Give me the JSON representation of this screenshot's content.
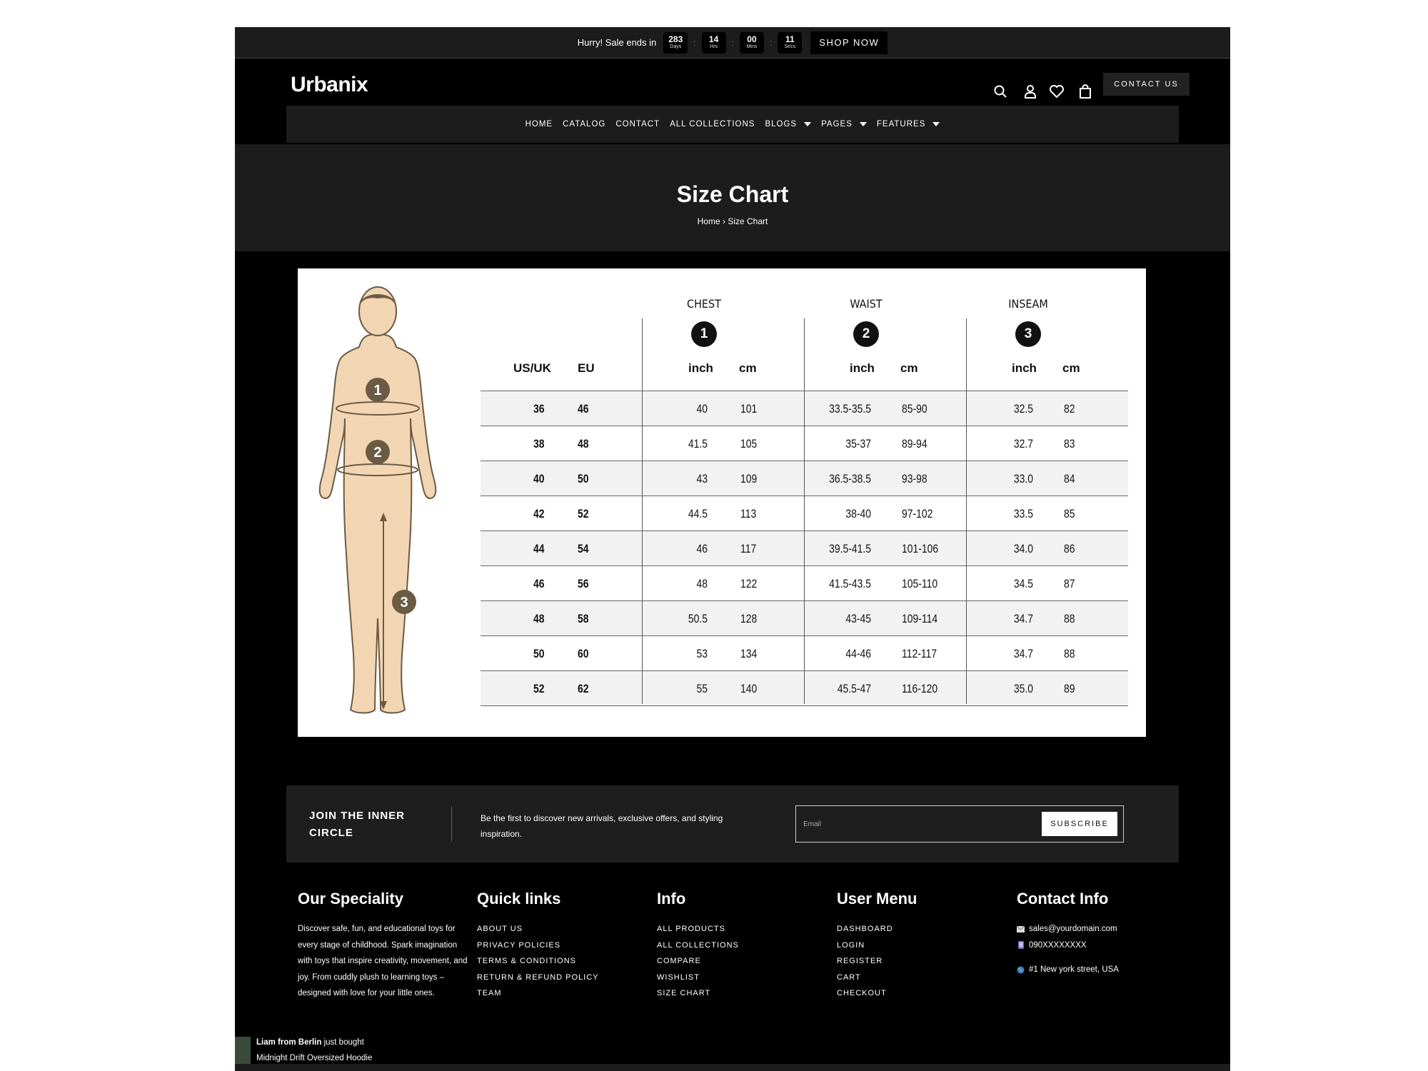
{
  "announcement": {
    "text": "Hurry! Sale ends in",
    "countdown": [
      {
        "value": "283",
        "unit": "Days"
      },
      {
        "value": "14",
        "unit": "Hrs"
      },
      {
        "value": "00",
        "unit": "Mins"
      },
      {
        "value": "11",
        "unit": "Secs"
      }
    ],
    "cta": "SHOP NOW"
  },
  "header": {
    "logo": "Urbanix",
    "contact_button": "CONTACT US",
    "icons": [
      "search-icon",
      "user-icon",
      "heart-icon",
      "bag-icon"
    ]
  },
  "nav": {
    "items": [
      {
        "label": "HOME",
        "dropdown": false
      },
      {
        "label": "CATALOG",
        "dropdown": false
      },
      {
        "label": "CONTACT",
        "dropdown": false
      },
      {
        "label": "ALL COLLECTIONS",
        "dropdown": false
      },
      {
        "label": "BLOGS",
        "dropdown": true
      },
      {
        "label": "PAGES",
        "dropdown": true
      },
      {
        "label": "FEATURES",
        "dropdown": true
      }
    ]
  },
  "hero": {
    "title": "Size Chart",
    "breadcrumb": {
      "home": "Home",
      "separator": "›",
      "current": "Size Chart"
    }
  },
  "size_chart": {
    "figure_markers": [
      "1",
      "2",
      "3"
    ],
    "measurements": [
      {
        "name": "CHEST",
        "marker": "1"
      },
      {
        "name": "WAIST",
        "marker": "2"
      },
      {
        "name": "INSEAM",
        "marker": "3"
      }
    ],
    "size_headers": [
      "US/UK",
      "EU"
    ],
    "unit_headers": [
      "inch",
      "cm"
    ],
    "rows": [
      {
        "us_uk": "36",
        "eu": "46",
        "chest_in": "40",
        "chest_cm": "101",
        "waist_in": "33.5-35.5",
        "waist_cm": "85-90",
        "inseam_in": "32.5",
        "inseam_cm": "82"
      },
      {
        "us_uk": "38",
        "eu": "48",
        "chest_in": "41.5",
        "chest_cm": "105",
        "waist_in": "35-37",
        "waist_cm": "89-94",
        "inseam_in": "32.7",
        "inseam_cm": "83"
      },
      {
        "us_uk": "40",
        "eu": "50",
        "chest_in": "43",
        "chest_cm": "109",
        "waist_in": "36.5-38.5",
        "waist_cm": "93-98",
        "inseam_in": "33.0",
        "inseam_cm": "84"
      },
      {
        "us_uk": "42",
        "eu": "52",
        "chest_in": "44.5",
        "chest_cm": "113",
        "waist_in": "38-40",
        "waist_cm": "97-102",
        "inseam_in": "33.5",
        "inseam_cm": "85"
      },
      {
        "us_uk": "44",
        "eu": "54",
        "chest_in": "46",
        "chest_cm": "117",
        "waist_in": "39.5-41.5",
        "waist_cm": "101-106",
        "inseam_in": "34.0",
        "inseam_cm": "86"
      },
      {
        "us_uk": "46",
        "eu": "56",
        "chest_in": "48",
        "chest_cm": "122",
        "waist_in": "41.5-43.5",
        "waist_cm": "105-110",
        "inseam_in": "34.5",
        "inseam_cm": "87"
      },
      {
        "us_uk": "48",
        "eu": "58",
        "chest_in": "50.5",
        "chest_cm": "128",
        "waist_in": "43-45",
        "waist_cm": "109-114",
        "inseam_in": "34.7",
        "inseam_cm": "88"
      },
      {
        "us_uk": "50",
        "eu": "60",
        "chest_in": "53",
        "chest_cm": "134",
        "waist_in": "44-46",
        "waist_cm": "112-117",
        "inseam_in": "34.7",
        "inseam_cm": "88"
      },
      {
        "us_uk": "52",
        "eu": "62",
        "chest_in": "55",
        "chest_cm": "140",
        "waist_in": "45.5-47",
        "waist_cm": "116-120",
        "inseam_in": "35.0",
        "inseam_cm": "89"
      }
    ]
  },
  "newsletter": {
    "title": "JOIN THE INNER CIRCLE",
    "text": "Be the first to discover new arrivals, exclusive offers, and styling inspiration.",
    "placeholder": "Email",
    "button": "SUBSCRIBE"
  },
  "footer": {
    "speciality": {
      "heading": "Our Speciality",
      "text": "Discover safe, fun, and educational toys for every stage of childhood. Spark imagination with toys that inspire creativity, movement, and joy. From cuddly plush to learning toys – designed with love for your little ones."
    },
    "quick_links": {
      "heading": "Quick links",
      "items": [
        "ABOUT US",
        "PRIVACY POLICIES",
        "TERMS & CONDITIONS",
        "RETURN & REFUND POLICY",
        "TEAM"
      ]
    },
    "info": {
      "heading": "Info",
      "items": [
        "ALL PRODUCTS",
        "ALL COLLECTIONS",
        "COMPARE",
        "WISHLIST",
        "SIZE CHART"
      ]
    },
    "user_menu": {
      "heading": "User Menu",
      "items": [
        "DASHBOARD",
        "LOGIN",
        "REGISTER",
        "CART",
        "CHECKOUT"
      ]
    },
    "contact": {
      "heading": "Contact Info",
      "email": "sales@yourdomain.com",
      "phone": "090XXXXXXXX",
      "address": "#1 New york street, USA"
    }
  },
  "toast": {
    "name": "Liam from Berlin",
    "action": "just bought",
    "product": "Midnight Drift Oversized Hoodie"
  }
}
